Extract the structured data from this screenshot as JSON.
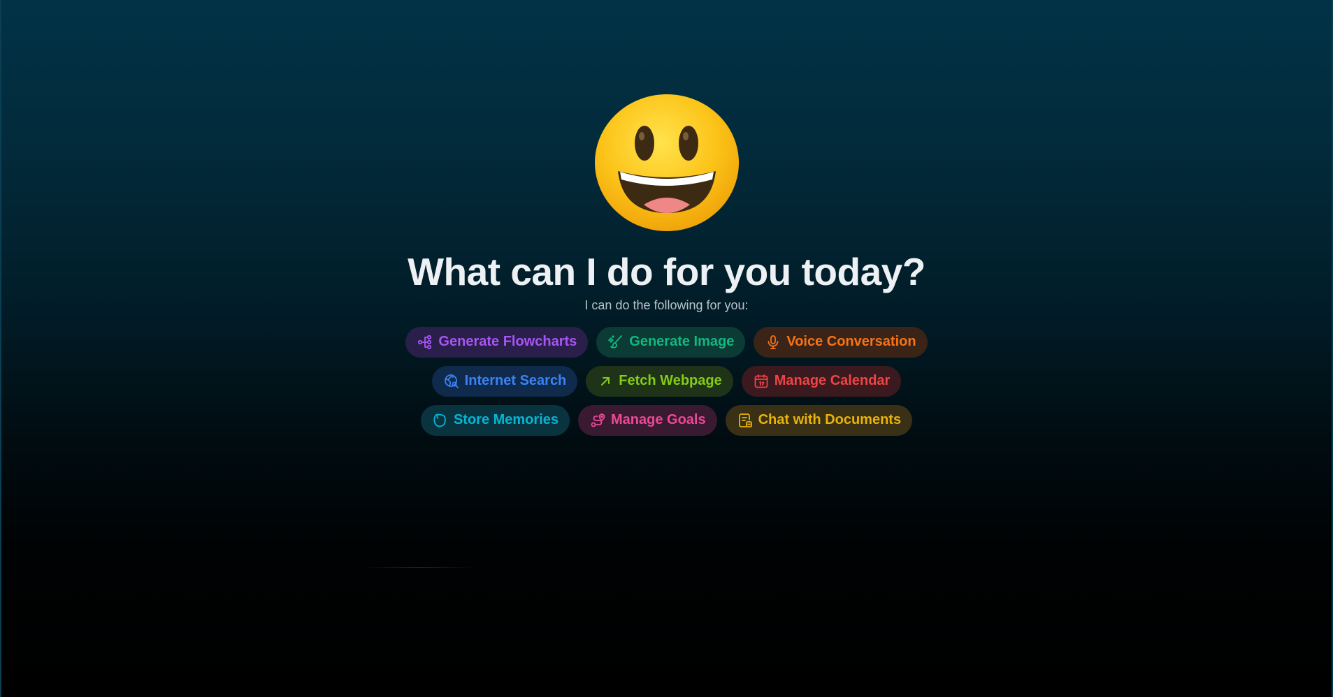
{
  "hero": {
    "emoji_icon": "grinning-face-emoji",
    "title": "What can I do for you today?",
    "subtitle": "I can do the following for you:"
  },
  "chips": [
    [
      {
        "label": "Generate Flowcharts",
        "icon": "flowchart-icon",
        "color": "#a855f7",
        "bg": "#2a1f4a"
      },
      {
        "label": "Generate Image",
        "icon": "image-brush-icon",
        "color": "#10b981",
        "bg": "#0c3a35"
      },
      {
        "label": "Voice Conversation",
        "icon": "microphone-icon",
        "color": "#f97316",
        "bg": "#3a2418"
      }
    ],
    [
      {
        "label": "Internet Search",
        "icon": "globe-search-icon",
        "color": "#3b82f6",
        "bg": "#0f2a4a"
      },
      {
        "label": "Fetch Webpage",
        "icon": "arrow-up-right-icon",
        "color": "#84cc16",
        "bg": "#1f3318"
      },
      {
        "label": "Manage Calendar",
        "icon": "calendar-icon",
        "color": "#ef4444",
        "bg": "#3a1a1f"
      }
    ],
    [
      {
        "label": "Store Memories",
        "icon": "memory-icon",
        "color": "#06b6d4",
        "bg": "#0a3340"
      },
      {
        "label": "Manage Goals",
        "icon": "goal-route-icon",
        "color": "#ec4899",
        "bg": "#3a1a30"
      },
      {
        "label": "Chat with Documents",
        "icon": "document-chat-icon",
        "color": "#eab308",
        "bg": "#3a3015"
      }
    ]
  ]
}
